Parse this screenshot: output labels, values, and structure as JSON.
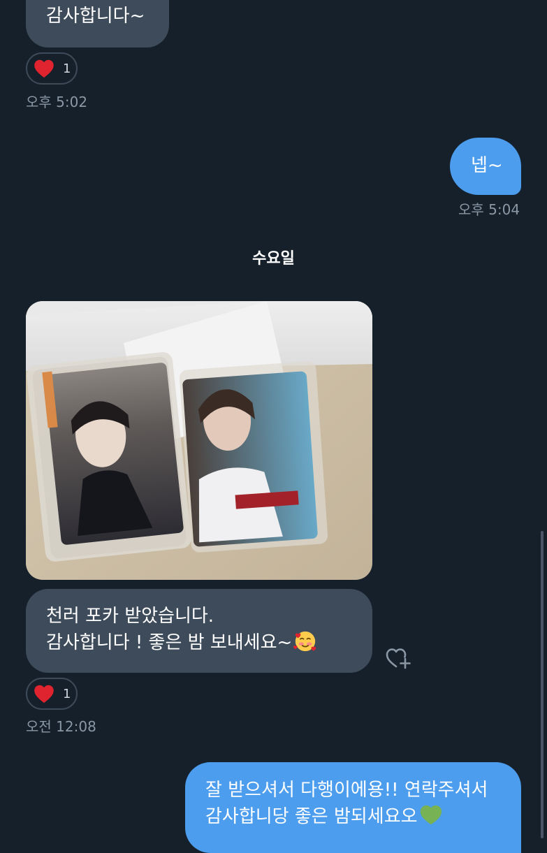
{
  "messages": {
    "m1": {
      "text": "감사합니다~"
    },
    "m1_reaction": {
      "emoji": "red-heart",
      "count": "1"
    },
    "m1_time": "오후 5:02",
    "m2": {
      "text": "넵~"
    },
    "m2_time": "오후 5:04",
    "day_divider": "수요일",
    "m3": {
      "photo": "photo-of-two-photocards-in-sleeves",
      "line1": "천러 포카 받았습니다.",
      "line2": "감사합니다 ! 좋은 밤 보내세요~",
      "emoji": "smiling-face-with-hearts"
    },
    "m3_reaction": {
      "emoji": "red-heart",
      "count": "1"
    },
    "m3_time": "오전 12:08",
    "m4": {
      "line1": "잘 받으셔서 다행이에용!! 연락주셔서",
      "line2": "감사합니당 좋은 밤되세요오",
      "emoji": "green-heart"
    }
  },
  "colors": {
    "background": "#16202b",
    "incoming_bubble": "#3e4b5a",
    "outgoing_bubble": "#4c9ded",
    "timestamp": "#8a97a4",
    "heart": "#e0242f"
  },
  "icons": {
    "add_reaction": "heart-plus-icon",
    "reaction": "red-heart-icon"
  }
}
